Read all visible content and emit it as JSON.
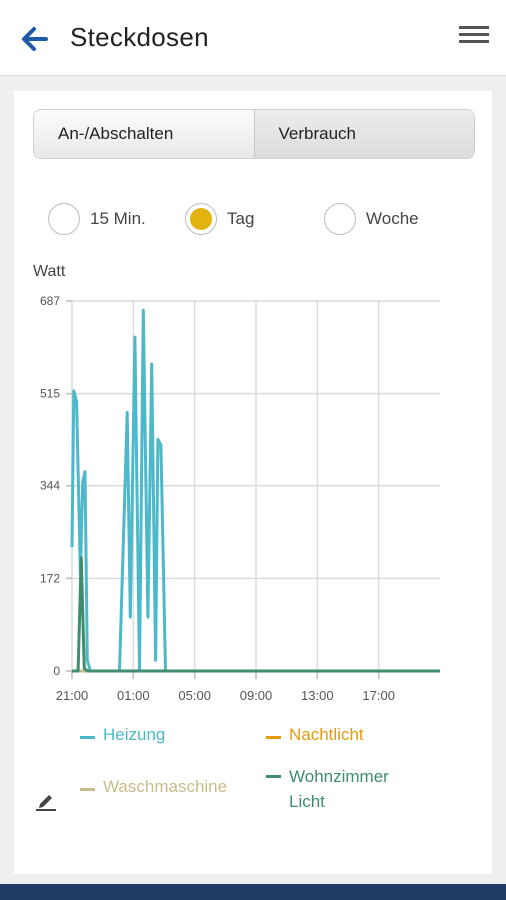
{
  "app": {
    "title": "Steckdosen"
  },
  "tabs": [
    {
      "label": "An-/Abschalten"
    },
    {
      "label": "Verbrauch"
    }
  ],
  "range_options": [
    {
      "label": "15 Min."
    },
    {
      "label": "Tag"
    },
    {
      "label": "Woche"
    }
  ],
  "selected_range": "Tag",
  "colors": {
    "accent": "#e2b20e",
    "heizung": "#4eb8cb",
    "nachtlicht": "#e69a0e",
    "waschmaschine": "#c8bd8a",
    "wohnzimmer_licht": "#3f8c6e",
    "bottom_bar": "#1e3b64"
  },
  "chart_data": {
    "type": "line",
    "ylabel": "Watt",
    "y_ticks": [
      "0",
      "172",
      "344",
      "515",
      "687"
    ],
    "ylim": [
      0,
      687
    ],
    "x_ticks": [
      "21:00",
      "01:00",
      "05:00",
      "09:00",
      "13:00",
      "17:00"
    ],
    "x_tick_hours": [
      0,
      4,
      8,
      12,
      16,
      20
    ],
    "xlim": [
      0,
      24
    ],
    "grid": true,
    "legend_position": "bottom",
    "series": [
      {
        "name": "Heizung",
        "color": "#4eb8cb",
        "points": [
          [
            0.0,
            230
          ],
          [
            0.12,
            520
          ],
          [
            0.3,
            500
          ],
          [
            0.55,
            180
          ],
          [
            0.7,
            350
          ],
          [
            0.85,
            370
          ],
          [
            1.0,
            20
          ],
          [
            1.2,
            0
          ],
          [
            3.1,
            0
          ],
          [
            3.6,
            480
          ],
          [
            3.8,
            100
          ],
          [
            4.1,
            620
          ],
          [
            4.4,
            0
          ],
          [
            4.65,
            670
          ],
          [
            4.95,
            100
          ],
          [
            5.2,
            570
          ],
          [
            5.45,
            20
          ],
          [
            5.6,
            430
          ],
          [
            5.8,
            420
          ],
          [
            6.1,
            0
          ],
          [
            24,
            0
          ]
        ]
      },
      {
        "name": "Nachtlicht",
        "color": "#e69a0e",
        "points": [
          [
            0,
            0
          ],
          [
            24,
            0
          ]
        ]
      },
      {
        "name": "Waschmaschine",
        "color": "#c8bd8a",
        "points": [
          [
            0,
            0
          ],
          [
            24,
            0
          ]
        ]
      },
      {
        "name": "Wohnzimmer Licht",
        "color": "#3f8c6e",
        "points": [
          [
            0,
            0
          ],
          [
            0.4,
            0
          ],
          [
            0.6,
            210
          ],
          [
            0.8,
            5
          ],
          [
            1.0,
            0
          ],
          [
            24,
            0
          ]
        ]
      }
    ]
  }
}
